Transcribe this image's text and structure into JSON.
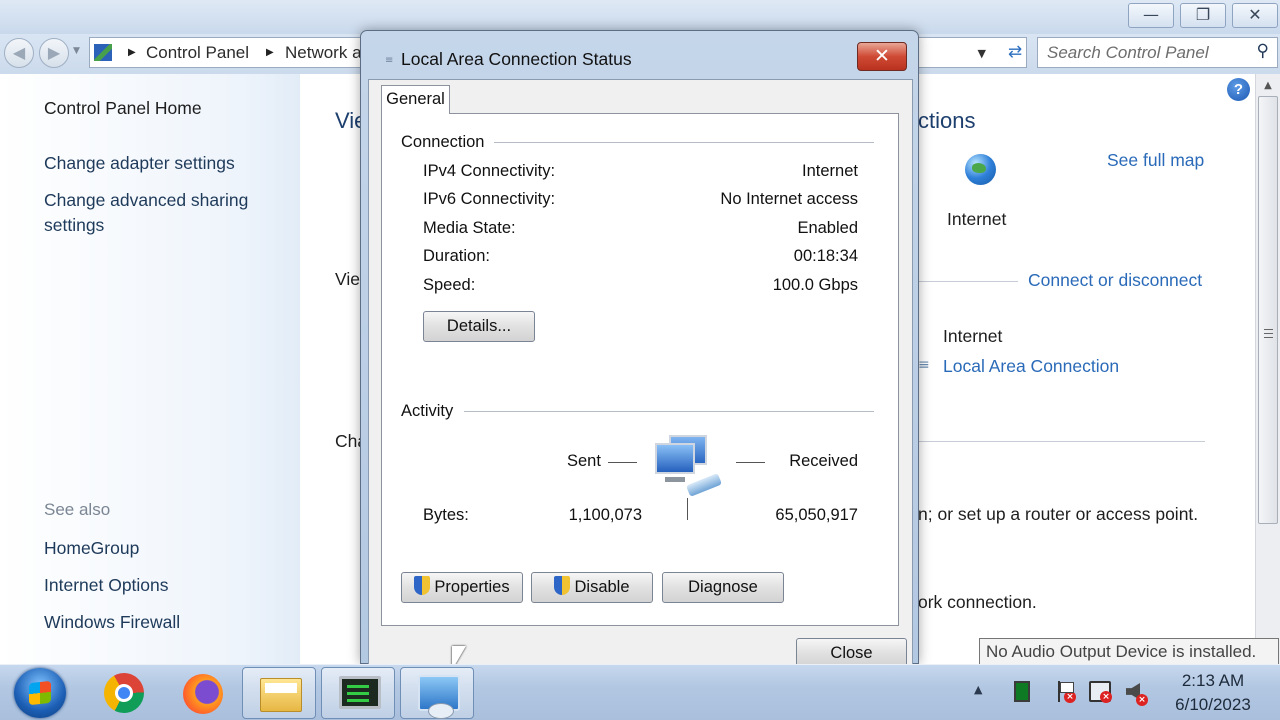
{
  "window": {
    "minimize_glyph": "—",
    "maximize_glyph": "❐",
    "close_glyph": "✕"
  },
  "address_bar": {
    "breadcrumbs": [
      "Control Panel",
      "Network a"
    ],
    "search_placeholder": "Search Control Panel"
  },
  "sidebar": {
    "home": "Control Panel Home",
    "links": [
      "Change adapter settings",
      "Change advanced sharing",
      "settings"
    ],
    "see_also_heading": "See also",
    "see_also": [
      "HomeGroup",
      "Internet Options",
      "Windows Firewall"
    ]
  },
  "content": {
    "title_left": "Vie",
    "title_right": "ctions",
    "see_full_map": "See full map",
    "internet_label": "Internet",
    "view_partial": "Vie",
    "connect_or_disconnect": "Connect or disconnect",
    "access_type_value": "Internet",
    "connection_link": "Local Area Connection",
    "change_partial": "Cha",
    "setup_text": "n; or set up a router or access point.",
    "network_text": "ork connection."
  },
  "dialog": {
    "title": "Local Area Connection Status",
    "tab": "General",
    "connection_group": "Connection",
    "rows": [
      {
        "key": "IPv4 Connectivity:",
        "value": "Internet"
      },
      {
        "key": "IPv6 Connectivity:",
        "value": "No Internet access"
      },
      {
        "key": "Media State:",
        "value": "Enabled"
      },
      {
        "key": "Duration:",
        "value": "00:18:34"
      },
      {
        "key": "Speed:",
        "value": "100.0 Gbps"
      }
    ],
    "details_button": "Details...",
    "activity_group": "Activity",
    "sent_label": "Sent",
    "received_label": "Received",
    "bytes_label": "Bytes:",
    "bytes_sent": "1,100,073",
    "bytes_received": "65,050,917",
    "properties_button": "Properties",
    "disable_button": "Disable",
    "diagnose_button": "Diagnose",
    "close_button": "Close"
  },
  "tooltip": "No Audio Output Device is installed.",
  "taskbar": {
    "time": "2:13 AM",
    "date": "6/10/2023",
    "tray_expand": "▲"
  }
}
